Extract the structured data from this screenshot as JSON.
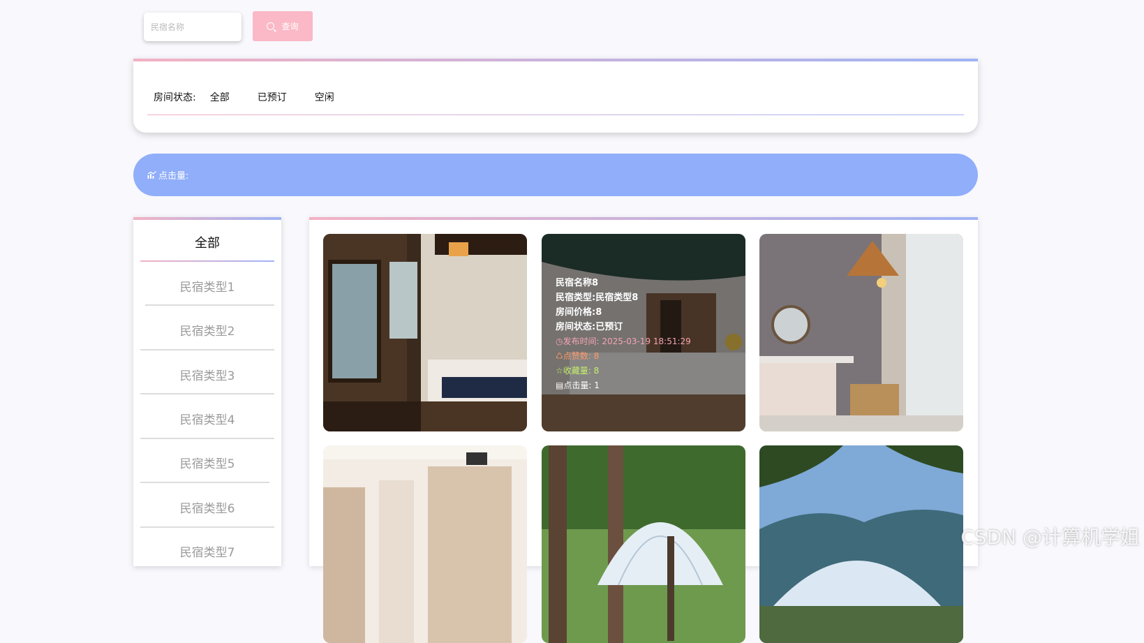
{
  "search": {
    "placeholder": "民宿名称",
    "button_label": "查询",
    "button_color": "#fbb8c6"
  },
  "filter": {
    "label": "房间状态:",
    "options": [
      "全部",
      "已预订",
      "空闲"
    ]
  },
  "banner": {
    "icon": "chart-icon",
    "text": "点击量:",
    "color": "#90aef9"
  },
  "sidebar": {
    "all_label": "全部",
    "items": [
      "民宿类型1",
      "民宿类型2",
      "民宿类型3",
      "民宿类型4",
      "民宿类型5",
      "民宿类型6",
      "民宿类型7"
    ]
  },
  "cards": {
    "hovered": {
      "name": "民宿名称8",
      "type": "民宿类型:民宿类型8",
      "price": "房间价格:8",
      "status": "房间状态:已预订",
      "publish_time": "发布时间: 2025-03-19 18:51:29",
      "likes": "点赞数: 8",
      "favorites": "收藏量: 8",
      "clicks": "点击量: 1"
    }
  },
  "watermark": "CSDN @计算机学姐",
  "colors": {
    "gradient_start": "#f3b1c3",
    "gradient_end": "#9fb3f5"
  }
}
